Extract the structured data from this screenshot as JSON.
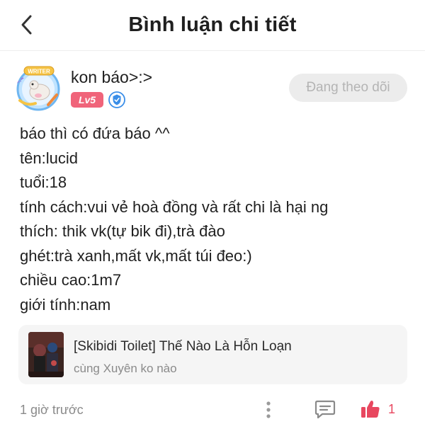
{
  "header": {
    "title": "Bình luận chi tiết",
    "back_icon": "chevron-left-icon"
  },
  "comment": {
    "author": {
      "name": "kon báo>:>",
      "avatar_badge_text": "WRITER",
      "level": "Lv5",
      "verified_icon": "shield-verified-icon"
    },
    "follow_button": "Đang theo dõi",
    "lines": [
      "báo thì có đứa báo ^^",
      "tên:lucid",
      "tuổi:18",
      "tính cách:vui vẻ hoà đồng và rất chi là hại ng",
      "thích: thik vk(tự bik đi),trà đào",
      "ghét:trà xanh,mất vk,mất túi đeo:)",
      "chiều cao:1m7",
      "giới tính:nam"
    ],
    "story": {
      "title": "[Skibidi Toilet] Thế Nào Là Hỗn Loạn",
      "author": "cùng Xuyên ko nào"
    },
    "timestamp": "1 giờ trước",
    "like_count": "1"
  },
  "colors": {
    "accent": "#e8475f",
    "level_badge": "#f0647a",
    "follow_bg": "#ececec",
    "follow_text": "#b4b4b4",
    "muted_text": "#8a8a8a",
    "card_bg": "#f5f5f5",
    "verified_blue": "#3a8ee8"
  }
}
